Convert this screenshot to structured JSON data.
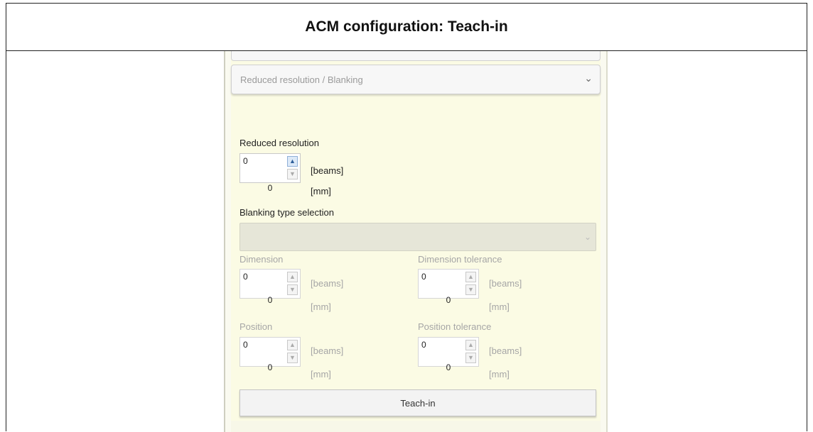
{
  "header": {
    "title": "ACM configuration: Teach-in"
  },
  "section": {
    "label": "Reduced resolution / Blanking"
  },
  "reduced_resolution": {
    "label": "Reduced resolution",
    "beams_value": "0",
    "beams_unit": "[beams]",
    "mm_value": "0",
    "mm_unit": "[mm]"
  },
  "blanking": {
    "label": "Blanking type selection",
    "selected": ""
  },
  "dimension": {
    "label": "Dimension",
    "beams_value": "0",
    "beams_unit": "[beams]",
    "mm_value": "0",
    "mm_unit": "[mm]"
  },
  "dimension_tolerance": {
    "label": "Dimension tolerance",
    "beams_value": "0",
    "beams_unit": "[beams]",
    "mm_value": "0",
    "mm_unit": "[mm]"
  },
  "position": {
    "label": "Position",
    "beams_value": "0",
    "beams_unit": "[beams]",
    "mm_value": "0",
    "mm_unit": "[mm]"
  },
  "position_tolerance": {
    "label": "Position tolerance",
    "beams_value": "0",
    "beams_unit": "[beams]",
    "mm_value": "0",
    "mm_unit": "[mm]"
  },
  "teach_button": {
    "label": "Teach-in"
  },
  "icons": {
    "up": "chevron-up-icon",
    "down": "chevron-down-icon"
  },
  "colors": {
    "panel_bg": "#fbfbe4",
    "disabled_text": "#a6a6a6",
    "spinner_active": "#dce9f8"
  }
}
